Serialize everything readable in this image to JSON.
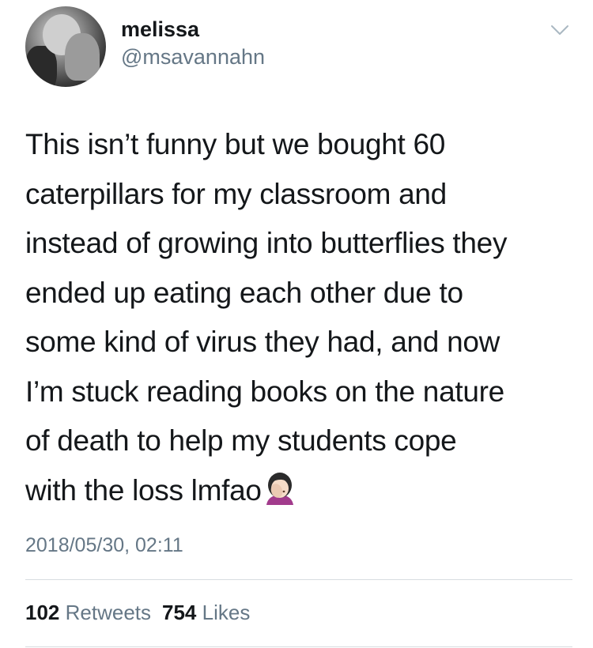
{
  "user": {
    "name": "melissa",
    "handle": "@msavannahn"
  },
  "tweet": {
    "lines": [
      "This isn’t funny but we bought 60",
      "caterpillars for my classroom and",
      "instead of growing into butterflies they",
      "ended up eating each other due to",
      "some kind of virus they had, and now",
      "I’m stuck reading books on the nature",
      "of death to help my students cope",
      "with the loss lmfao"
    ],
    "emoji": "face-palm-emoji",
    "timestamp": "2018/05/30, 02:11"
  },
  "stats": {
    "retweets_count": "102",
    "retweets_label": "Retweets",
    "likes_count": "754",
    "likes_label": "Likes"
  },
  "icons": {
    "menu": "chevron-down-icon"
  },
  "colors": {
    "text": "#14171a",
    "secondary": "#657786",
    "divider": "#d8dde1"
  }
}
